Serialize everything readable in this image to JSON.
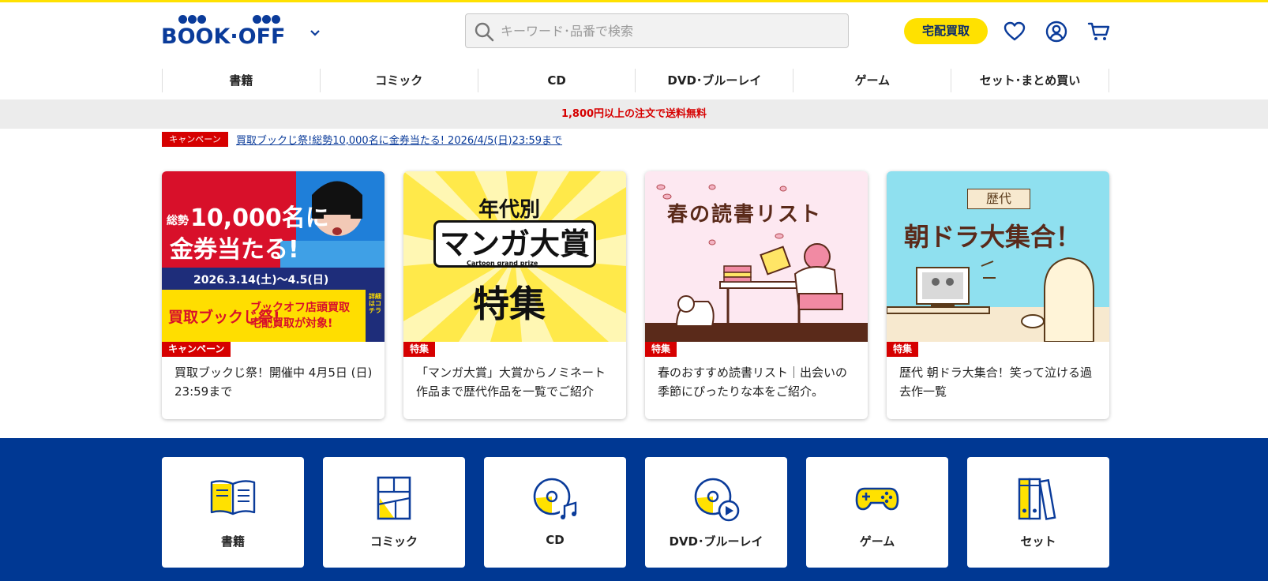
{
  "header": {
    "logo_text": "BOOK·OFF",
    "search_placeholder": "キーワード･品番で検索",
    "buy_button": "宅配買取"
  },
  "nav": [
    "書籍",
    "コミック",
    "CD",
    "DVD･ブルーレイ",
    "ゲーム",
    "セット･まとめ買い"
  ],
  "shipping_notice": "1,800円以上の注文で送料無料",
  "campaign": {
    "badge": "キャンペーン",
    "link": "買取ブックじ祭!総勢10,000名に金券当たる! 2026/4/5(日)23:59まで"
  },
  "cards": [
    {
      "tag": "キャンペーン",
      "text": "買取ブックじ祭！開催中 4月5日 (日) 23:59まで",
      "banner": {
        "line1": "総勢",
        "line2": "10,000名に",
        "line3": "金券当たる!",
        "dates": "2026.3.14(土)～4.5(日)",
        "logo": "買取ブックじ祭!",
        "sub1": "ブックオフ店頭買取",
        "sub2": "宅配買取が対象!",
        "side": "詳細はコチラ"
      }
    },
    {
      "tag": "特集",
      "text": "「マンガ大賞」大賞からノミネート作品まで歴代作品を一覧でご紹介",
      "banner": {
        "top": "年代別",
        "main": "マンガ大賞",
        "en": "Cartoon grand prize",
        "bottom": "特集"
      }
    },
    {
      "tag": "特集",
      "text": "春のおすすめ読書リスト｜出会いの季節にぴったりな本をご紹介。",
      "banner": {
        "title": "春の読書リスト"
      }
    },
    {
      "tag": "特集",
      "text": "歴代 朝ドラ大集合！笑って泣ける過去作一覧",
      "banner": {
        "label": "歴代",
        "title": "朝ドラ大集合！"
      }
    }
  ],
  "categories": [
    "書籍",
    "コミック",
    "CD",
    "DVD･ブルーレイ",
    "ゲーム",
    "セット"
  ],
  "colors": {
    "brand_blue": "#003893",
    "accent_yellow": "#ffe100",
    "red": "#d60000"
  }
}
